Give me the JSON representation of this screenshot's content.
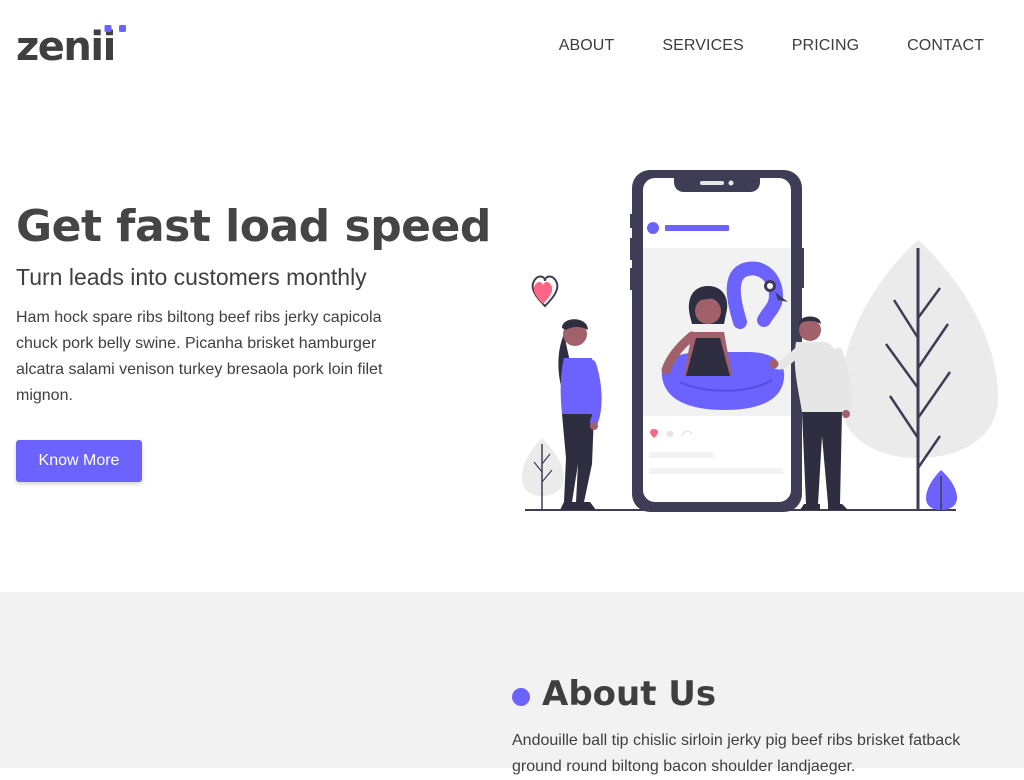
{
  "brand": {
    "logo_text": "zenii",
    "accent_color": "#6c63ff",
    "text_color": "#3f3f3f"
  },
  "nav": {
    "items": [
      {
        "label": "ABOUT"
      },
      {
        "label": "SERVICES"
      },
      {
        "label": "PRICING"
      },
      {
        "label": "CONTACT"
      }
    ]
  },
  "hero": {
    "title": "Get fast load speed",
    "subtitle": "Turn leads into customers monthly",
    "body": "Ham hock spare ribs biltong beef ribs jerky capicola chuck pork belly swine. Picanha brisket hamburger alcatra salami venison turkey bresaola pork loin filet mignon.",
    "button_label": "Know More",
    "illustration": "people-with-phone-social-post-illustration"
  },
  "about": {
    "title": "About Us",
    "body": "Andouille ball tip chislic sirloin jerky pig beef ribs brisket fatback ground round biltong bacon shoulder landjaeger."
  }
}
